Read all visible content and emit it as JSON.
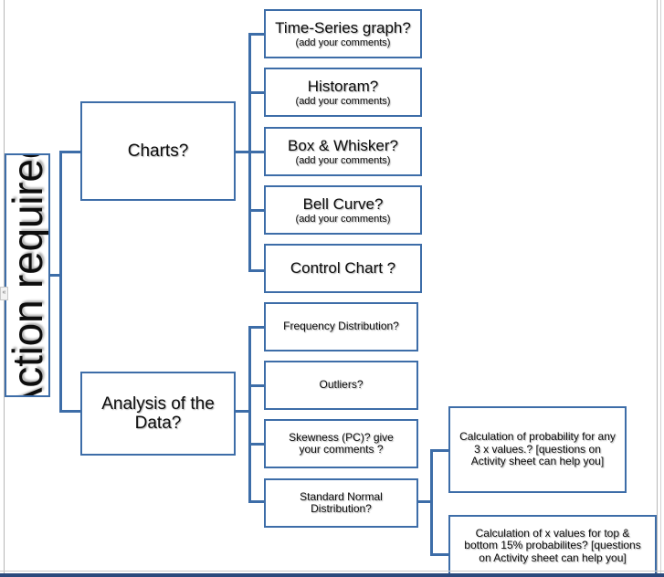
{
  "diagram": {
    "root": {
      "label": "Action required"
    },
    "branches": [
      {
        "label": "Charts?",
        "children": [
          {
            "title": "Time-Series graph?",
            "sub": "(add your comments)"
          },
          {
            "title": "Historam?",
            "sub": "(add your comments)"
          },
          {
            "title": "Box & Whisker?",
            "sub": "(add your comments)"
          },
          {
            "title": "Bell Curve?",
            "sub": "(add your comments)"
          },
          {
            "title": "Control Chart ?",
            "sub": ""
          }
        ]
      },
      {
        "label": "Analysis of the Data?",
        "children": [
          {
            "title": "Frequency Distribution?",
            "sub": ""
          },
          {
            "title": "Outliers?",
            "sub": ""
          },
          {
            "title": "Skewness (PC)? give your comments ?",
            "sub": ""
          },
          {
            "title": "Standard Normal Distribution?",
            "sub": "",
            "children": [
              {
                "title": "Calculation of probability for any 3 x values.? [questions on Activity sheet can help you]"
              },
              {
                "title": "Calculation of x values for top & bottom 15% probabilites? [questions on Activity sheet can help you]"
              }
            ]
          }
        ]
      }
    ]
  },
  "colors": {
    "shape_border": "#3d6DA8",
    "text": "#0d0d0d",
    "bottom_bar": "#2b4a7d",
    "page_rule": "#b7b7b7"
  }
}
